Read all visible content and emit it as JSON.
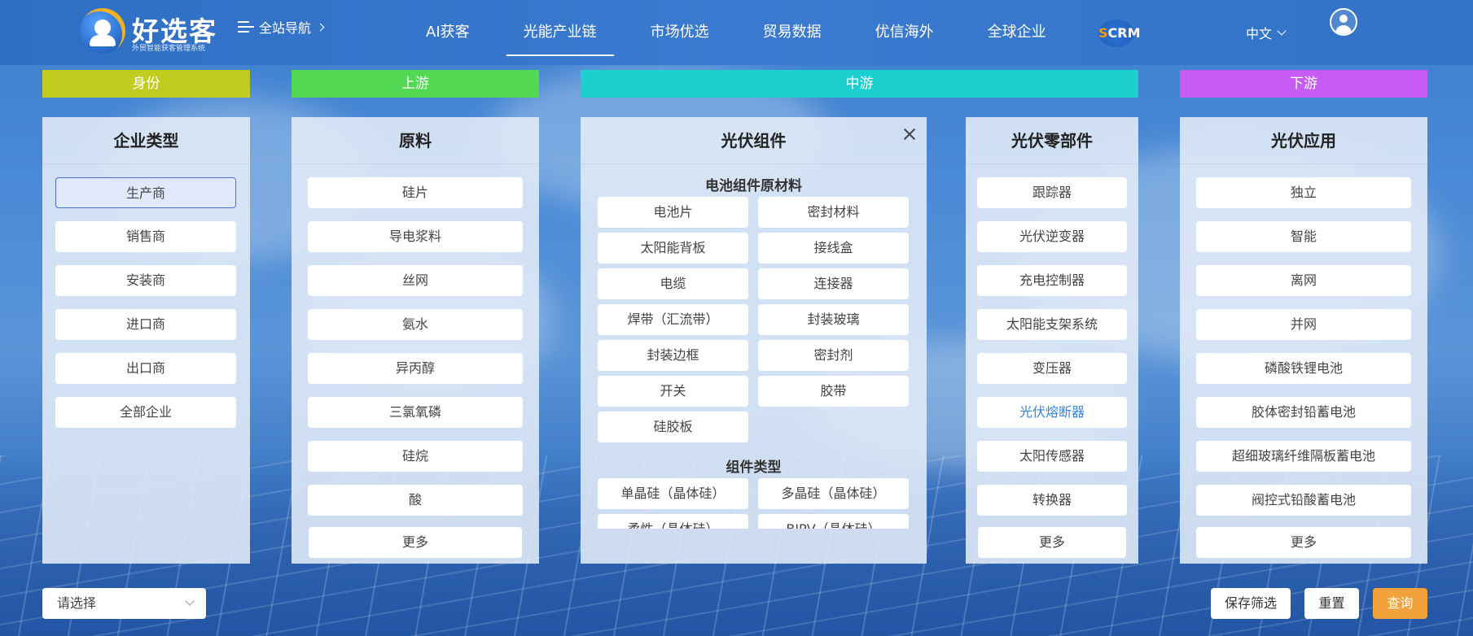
{
  "header": {
    "logo_title": "好选客",
    "logo_subtitle": "外贸智能获客管理系统",
    "site_nav_label": "全站导航",
    "nav": [
      "AI获客",
      "光能产业链",
      "市场优选",
      "贸易数据",
      "优信海外",
      "全球企业"
    ],
    "active_nav": "光能产业链",
    "scrm_prefix": "S",
    "scrm_label": "CRM",
    "language": "中文"
  },
  "stages": {
    "identity": {
      "label": "身份",
      "color": "#c2cc1f"
    },
    "upstream": {
      "label": "上游",
      "color": "#52d853"
    },
    "midstream": {
      "label": "中游",
      "color": "#1dd0d0"
    },
    "downstream": {
      "label": "下游",
      "color": "#c75cf4"
    }
  },
  "enterprise_type": {
    "title": "企业类型",
    "options": [
      "生产商",
      "销售商",
      "安装商",
      "进口商",
      "出口商",
      "全部企业"
    ],
    "selected": "生产商"
  },
  "raw_materials": {
    "title": "原料",
    "options": [
      "硅片",
      "导电浆料",
      "丝网",
      "氨水",
      "异丙醇",
      "三氯氧磷",
      "硅烷",
      "酸",
      "更多"
    ]
  },
  "pv_module": {
    "title": "光伏组件",
    "section1_title": "电池组件原材料",
    "section1_options": [
      "电池片",
      "密封材料",
      "太阳能背板",
      "接线盒",
      "电缆",
      "连接器",
      "焊带（汇流带）",
      "封装玻璃",
      "封装边框",
      "密封剂",
      "开关",
      "胶带",
      "硅胶板"
    ],
    "section2_title": "组件类型",
    "section2_options": [
      "单晶硅（晶体硅）",
      "多晶硅（晶体硅）",
      "柔性（晶体硅）",
      "BIPV（晶体硅）"
    ]
  },
  "pv_parts": {
    "title": "光伏零部件",
    "options": [
      "跟踪器",
      "光伏逆变器",
      "充电控制器",
      "太阳能支架系统",
      "变压器",
      "光伏熔断器",
      "太阳传感器",
      "转换器",
      "更多"
    ],
    "highlighted": "光伏熔断器"
  },
  "pv_applications": {
    "title": "光伏应用",
    "options": [
      "独立",
      "智能",
      "离网",
      "并网",
      "磷酸铁锂电池",
      "胶体密封铅蓄电池",
      "超细玻璃纤维隔板蓄电池",
      "阀控式铅酸蓄电池",
      "更多"
    ]
  },
  "footer": {
    "select_placeholder": "请选择",
    "save_filter": "保存筛选",
    "reset": "重置",
    "query": "查询"
  }
}
